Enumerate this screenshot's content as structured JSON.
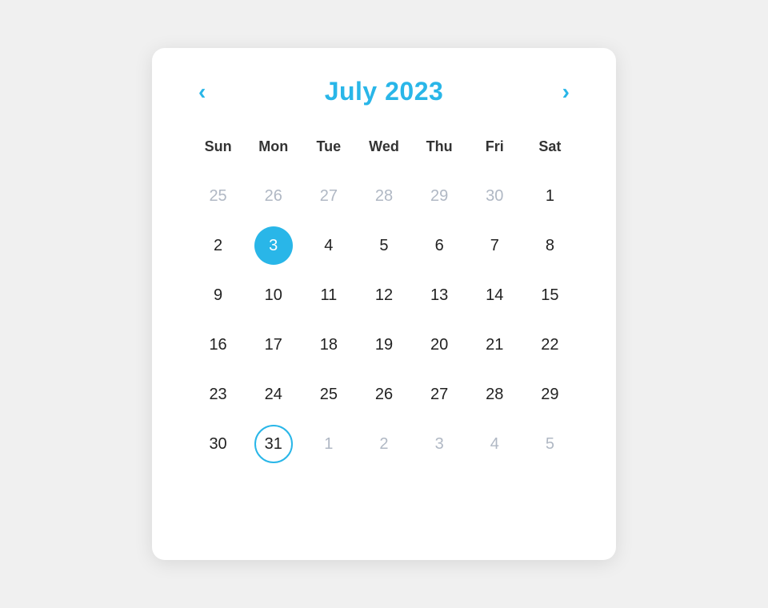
{
  "calendar": {
    "title": "July 2023",
    "prev_label": "‹",
    "next_label": "›",
    "day_headers": [
      "Sun",
      "Mon",
      "Tue",
      "Wed",
      "Thu",
      "Fri",
      "Sat"
    ],
    "weeks": [
      [
        {
          "day": "25",
          "type": "out-of-month"
        },
        {
          "day": "26",
          "type": "out-of-month"
        },
        {
          "day": "27",
          "type": "out-of-month"
        },
        {
          "day": "28",
          "type": "out-of-month"
        },
        {
          "day": "29",
          "type": "out-of-month"
        },
        {
          "day": "30",
          "type": "out-of-month"
        },
        {
          "day": "1",
          "type": "normal"
        }
      ],
      [
        {
          "day": "2",
          "type": "normal"
        },
        {
          "day": "3",
          "type": "selected"
        },
        {
          "day": "4",
          "type": "normal"
        },
        {
          "day": "5",
          "type": "normal"
        },
        {
          "day": "6",
          "type": "normal"
        },
        {
          "day": "7",
          "type": "normal"
        },
        {
          "day": "8",
          "type": "normal"
        }
      ],
      [
        {
          "day": "9",
          "type": "normal"
        },
        {
          "day": "10",
          "type": "normal"
        },
        {
          "day": "11",
          "type": "normal"
        },
        {
          "day": "12",
          "type": "normal"
        },
        {
          "day": "13",
          "type": "normal"
        },
        {
          "day": "14",
          "type": "normal"
        },
        {
          "day": "15",
          "type": "normal"
        }
      ],
      [
        {
          "day": "16",
          "type": "normal"
        },
        {
          "day": "17",
          "type": "normal"
        },
        {
          "day": "18",
          "type": "normal"
        },
        {
          "day": "19",
          "type": "normal"
        },
        {
          "day": "20",
          "type": "normal"
        },
        {
          "day": "21",
          "type": "normal"
        },
        {
          "day": "22",
          "type": "normal"
        }
      ],
      [
        {
          "day": "23",
          "type": "normal"
        },
        {
          "day": "24",
          "type": "normal"
        },
        {
          "day": "25",
          "type": "normal"
        },
        {
          "day": "26",
          "type": "normal"
        },
        {
          "day": "27",
          "type": "normal"
        },
        {
          "day": "28",
          "type": "normal"
        },
        {
          "day": "29",
          "type": "normal"
        }
      ],
      [
        {
          "day": "30",
          "type": "normal"
        },
        {
          "day": "31",
          "type": "today-outlined"
        },
        {
          "day": "1",
          "type": "out-of-month"
        },
        {
          "day": "2",
          "type": "out-of-month"
        },
        {
          "day": "3",
          "type": "out-of-month"
        },
        {
          "day": "4",
          "type": "out-of-month"
        },
        {
          "day": "5",
          "type": "out-of-month"
        }
      ]
    ]
  }
}
